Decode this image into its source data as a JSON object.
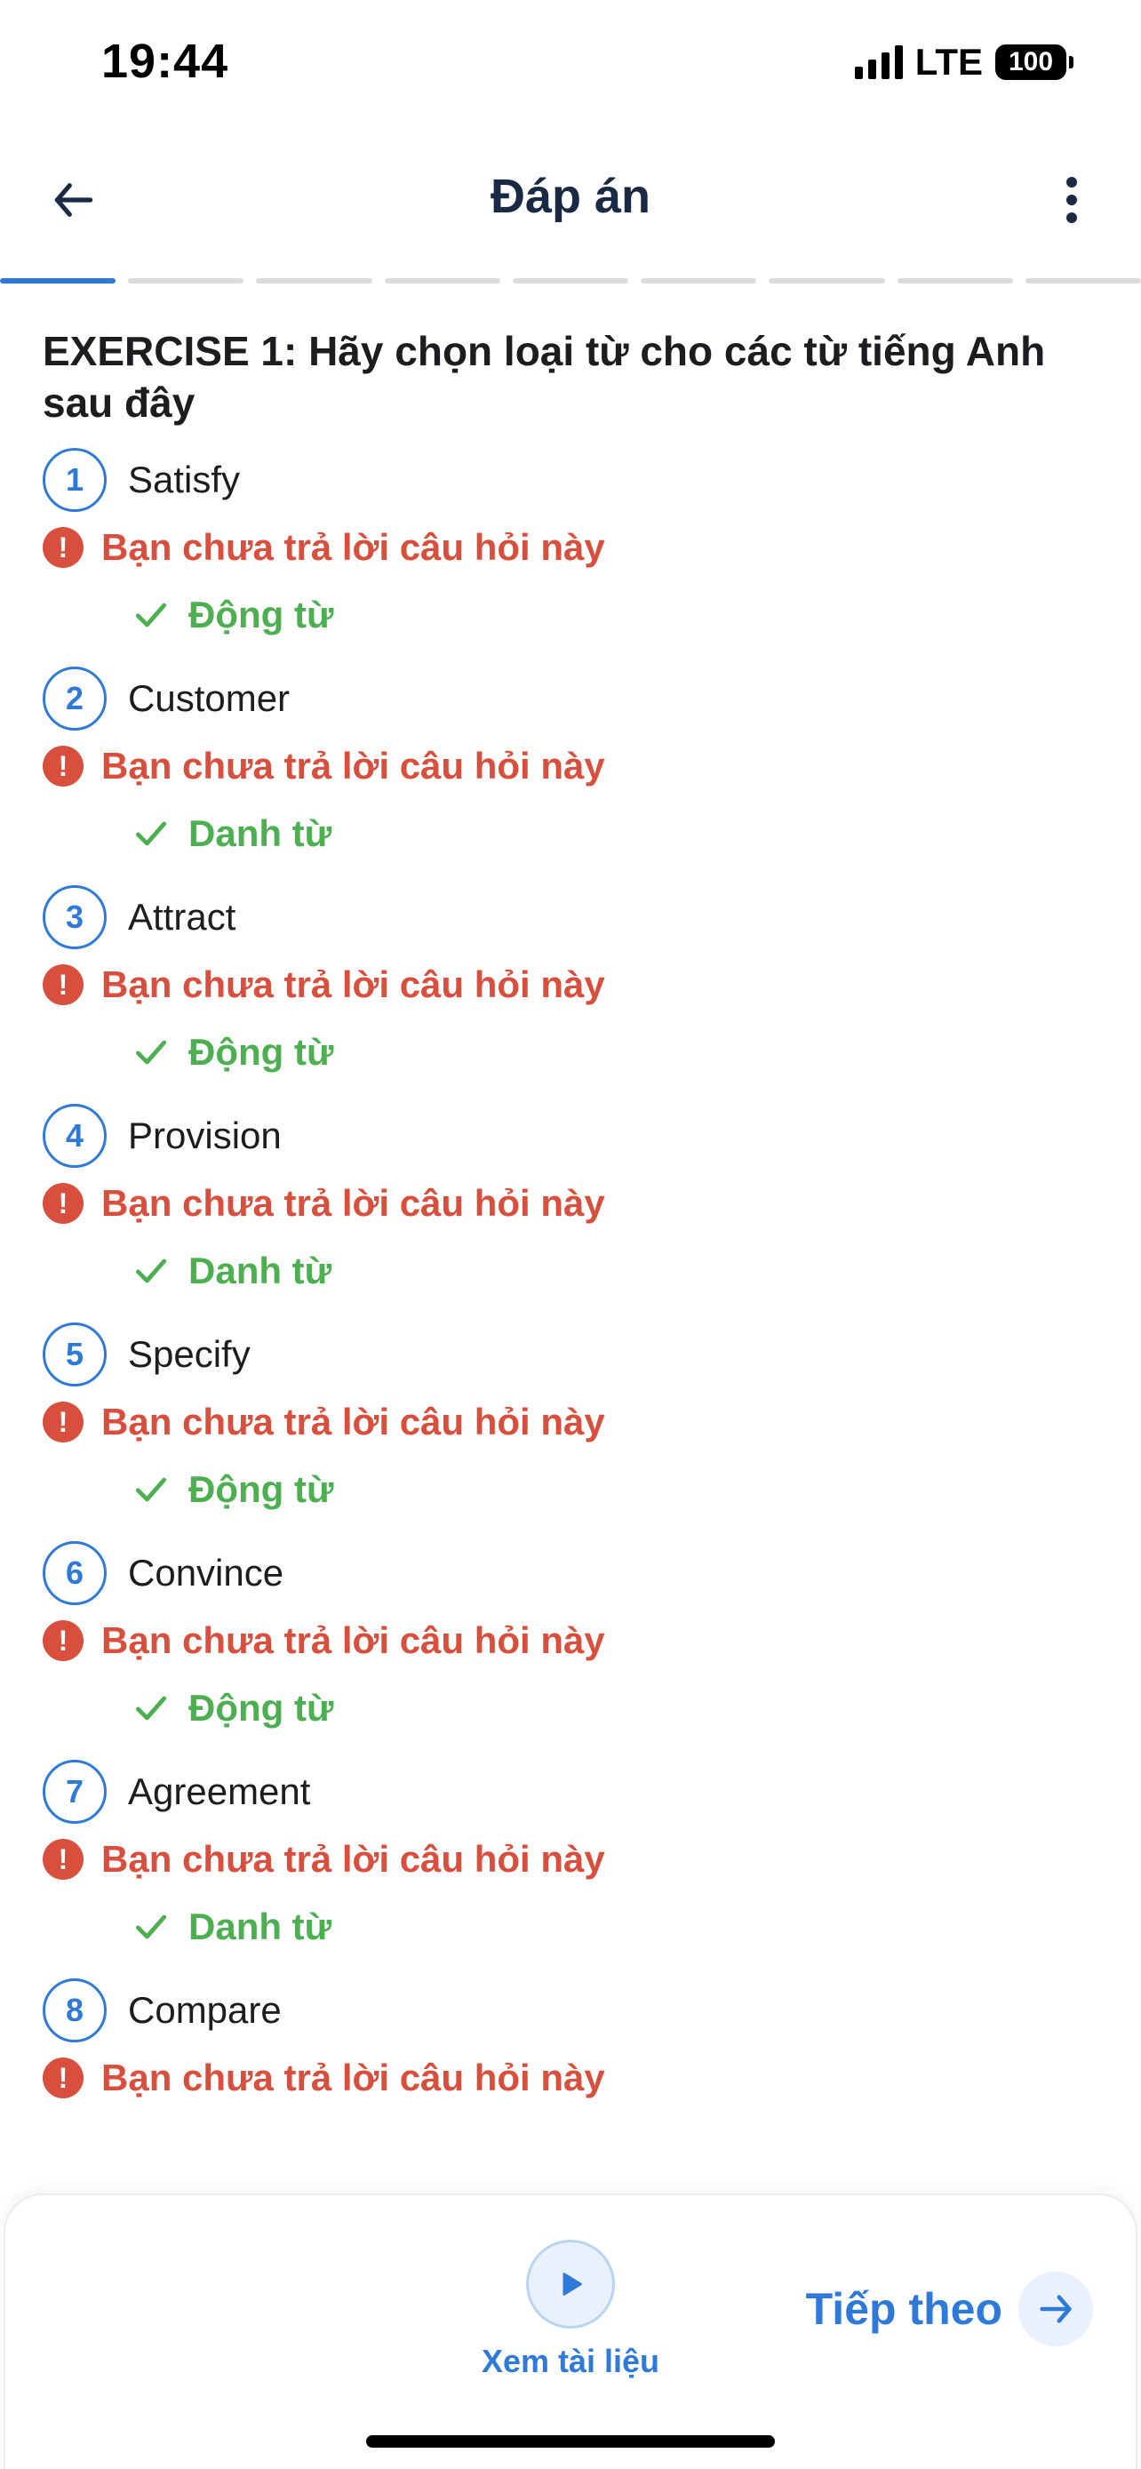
{
  "status_bar": {
    "time": "19:44",
    "network": "LTE",
    "battery": "100"
  },
  "header": {
    "title": "Đáp án",
    "back_icon": "arrow-left-icon",
    "menu_icon": "more-vertical-icon"
  },
  "progress": {
    "total_segments": 9,
    "active_index": 0
  },
  "exercise": {
    "title": "EXERCISE 1: Hãy chọn loại từ cho các từ tiếng Anh sau đây",
    "unanswered_text": "Bạn chưa trả lời câu hỏi này",
    "questions": [
      {
        "number": "1",
        "word": "Satisfy",
        "answer": "Động từ"
      },
      {
        "number": "2",
        "word": "Customer",
        "answer": "Danh từ"
      },
      {
        "number": "3",
        "word": "Attract",
        "answer": "Động từ"
      },
      {
        "number": "4",
        "word": "Provision",
        "answer": "Danh từ"
      },
      {
        "number": "5",
        "word": "Specify",
        "answer": "Động từ"
      },
      {
        "number": "6",
        "word": "Convince",
        "answer": "Động từ"
      },
      {
        "number": "7",
        "word": "Agreement",
        "answer": "Danh từ"
      },
      {
        "number": "8",
        "word": "Compare",
        "answer": ""
      }
    ]
  },
  "bottom": {
    "docs_label": "Xem tài liệu",
    "next_label": "Tiếp theo"
  },
  "colors": {
    "accent": "#2f7ad8",
    "error": "#d94f3d",
    "success": "#4caf50"
  }
}
